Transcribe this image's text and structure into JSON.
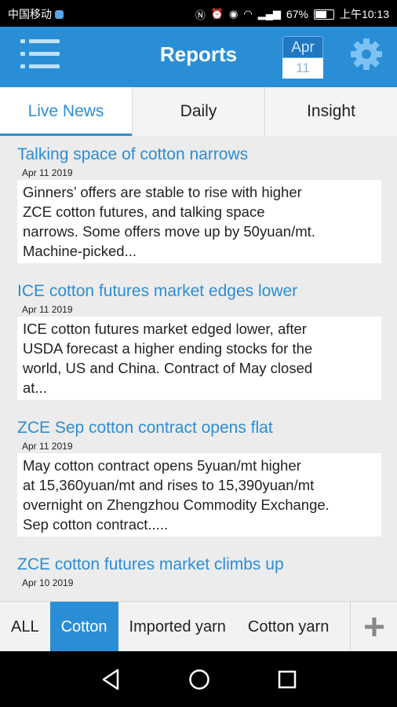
{
  "status_bar": {
    "carrier": "中国移动",
    "battery": "67%",
    "time": "上午10:13",
    "icons": [
      "nfc-icon",
      "alarm-icon",
      "eye-icon",
      "wifi-icon",
      "signal-icon",
      "battery-icon"
    ]
  },
  "app_bar": {
    "title": "Reports",
    "calendar_month": "Apr",
    "calendar_day": "11",
    "color": "#2a8ed7"
  },
  "tabs": [
    {
      "label": "Live News",
      "active": true
    },
    {
      "label": "Daily",
      "active": false
    },
    {
      "label": "Insight",
      "active": false
    }
  ],
  "news": [
    {
      "title": "Talking space of cotton narrows",
      "date": "Apr 11 2019",
      "summary_lines": [
        "Ginners’ offers are stable to rise with higher",
        "ZCE cotton futures, and talking space",
        "narrows. Some offers move up by 50yuan/mt.",
        "Machine-picked..."
      ]
    },
    {
      "title": "ICE cotton futures market edges lower",
      "date": "Apr 11 2019",
      "summary_lines": [
        "ICE cotton futures market edged lower, after",
        "USDA forecast a higher ending stocks for the",
        "world, US and China. Contract of May closed",
        "at..."
      ]
    },
    {
      "title": "ZCE Sep cotton contract opens flat",
      "date": "Apr 11 2019",
      "summary_lines": [
        "May cotton contract opens 5yuan/mt higher",
        "at 15,360yuan/mt and rises to 15,390yuan/mt",
        "overnight on Zhengzhou Commodity Exchange.",
        "Sep cotton contract....."
      ]
    },
    {
      "title": "ZCE cotton futures market climbs up",
      "date": "Apr 10 2019",
      "summary_lines": []
    }
  ],
  "categories": [
    {
      "label": "ALL",
      "active": false
    },
    {
      "label": "Cotton",
      "active": true
    },
    {
      "label": "Imported yarn",
      "active": false
    },
    {
      "label": "Cotton yarn",
      "active": false
    }
  ]
}
